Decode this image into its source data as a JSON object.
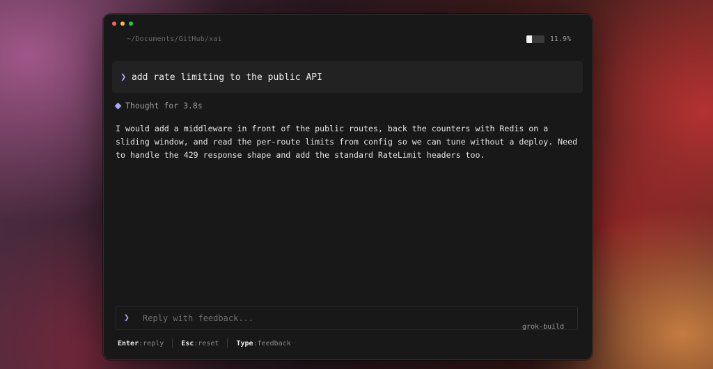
{
  "window": {
    "path": "~/Documents/GitHub/xai",
    "usage": {
      "percent_label": "11.9%",
      "fill_fraction": 0.119
    }
  },
  "prompt": {
    "chevron": "❯",
    "text": "add rate limiting to the public API"
  },
  "thought": {
    "icon": "diamond-icon",
    "label": "Thought for 3.8s"
  },
  "response": {
    "text": "I would add a middleware in front of the public routes, back the counters with Redis on a\nsliding window, and read the per-route limits from config so we can tune without a deploy. Need\nto handle the 429 response shape and add the standard RateLimit headers too."
  },
  "reply": {
    "chevron": "❯",
    "placeholder": "Reply with feedback...",
    "value": ""
  },
  "model_label": "grok-build",
  "hints": [
    {
      "key": "Enter",
      "sep": ":",
      "action": "reply"
    },
    {
      "key": "Esc",
      "sep": ":",
      "action": "reset"
    },
    {
      "key": "Type",
      "sep": ":",
      "action": "feedback"
    }
  ],
  "colors": {
    "accent": "#a9a6ff",
    "window_bg": "#181818",
    "prompt_bg": "#222222"
  }
}
